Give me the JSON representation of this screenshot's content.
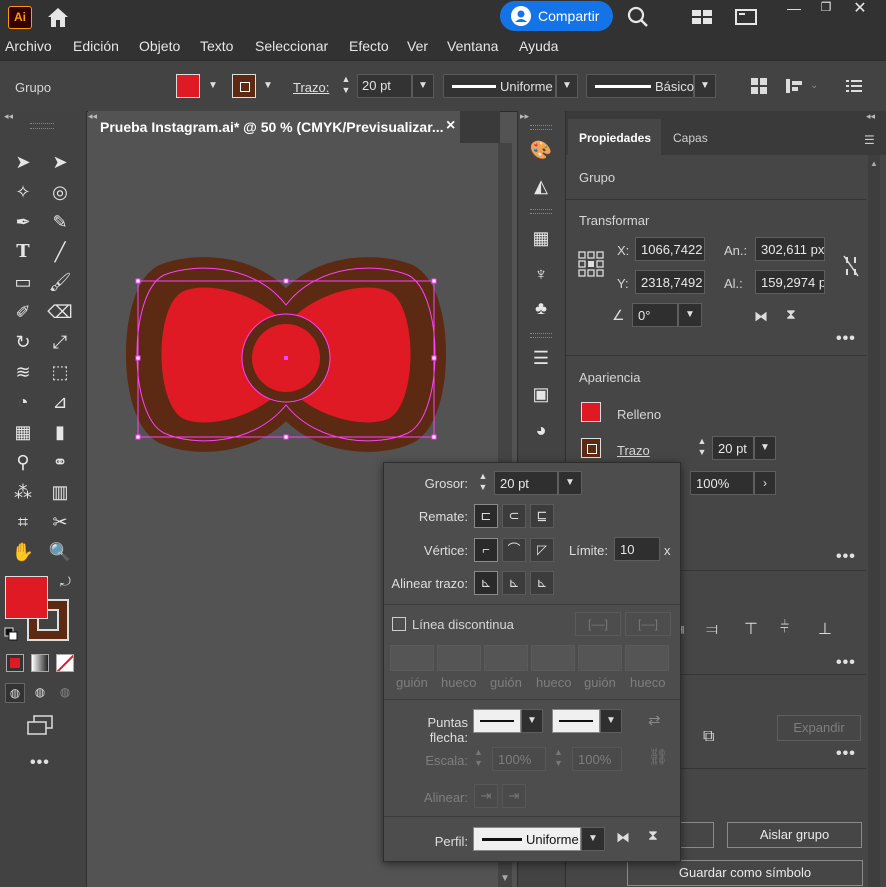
{
  "app": {
    "logo": "Ai",
    "share_label": "Compartir"
  },
  "menu": [
    "Archivo",
    "Edición",
    "Objeto",
    "Texto",
    "Seleccionar",
    "Efecto",
    "Ver",
    "Ventana",
    "Ayuda"
  ],
  "control_bar": {
    "selection_label": "Grupo",
    "stroke_label": "Trazo:",
    "stroke_weight": "20 pt",
    "profile_label": "Uniforme",
    "brush_label": "Básico",
    "fill_color": "#e01a24",
    "stroke_color": "#5c2a12"
  },
  "document": {
    "tab_title": "Prueba Instagram.ai* @ 50 % (CMYK/Previsualizar...",
    "close": "×"
  },
  "properties": {
    "tabs": [
      "Propiedades",
      "Capas"
    ],
    "object_type": "Grupo",
    "transform": {
      "title": "Transformar",
      "x_label": "X:",
      "x": "1066,7422",
      "y_label": "Y:",
      "y": "2318,7492",
      "w_label": "An.:",
      "w": "302,611 px",
      "h_label": "Al.:",
      "h": "159,2974 p",
      "angle": "0°"
    },
    "appearance": {
      "title": "Apariencia",
      "fill_label": "Relleno",
      "stroke_label": "Trazo",
      "stroke_weight": "20 pt",
      "opacity": "100%"
    },
    "expand_label": "Expandir",
    "isolate_label": "Aislar grupo",
    "save_symbol_label": "Guardar como símbolo"
  },
  "stroke_panel": {
    "weight_label": "Grosor:",
    "weight": "20 pt",
    "cap_label": "Remate:",
    "corner_label": "Vértice:",
    "limit_label": "Límite:",
    "limit": "10",
    "limit_unit": "x",
    "align_label": "Alinear trazo:",
    "dashed_label": "Línea discontinua",
    "dash_labels": [
      "guión",
      "hueco",
      "guión",
      "hueco",
      "guión",
      "hueco"
    ],
    "arrowheads_label": "Puntas flecha:",
    "scale_label": "Escala:",
    "scale_start": "100%",
    "scale_end": "100%",
    "align_arrows_label": "Alinear:",
    "profile_label": "Perfil:",
    "profile": "Uniforme"
  },
  "colors": {
    "accent": "#1473e6",
    "bow_fill": "#e01a24",
    "bow_stroke": "#5c2a12",
    "selection": "#ff40ff"
  }
}
